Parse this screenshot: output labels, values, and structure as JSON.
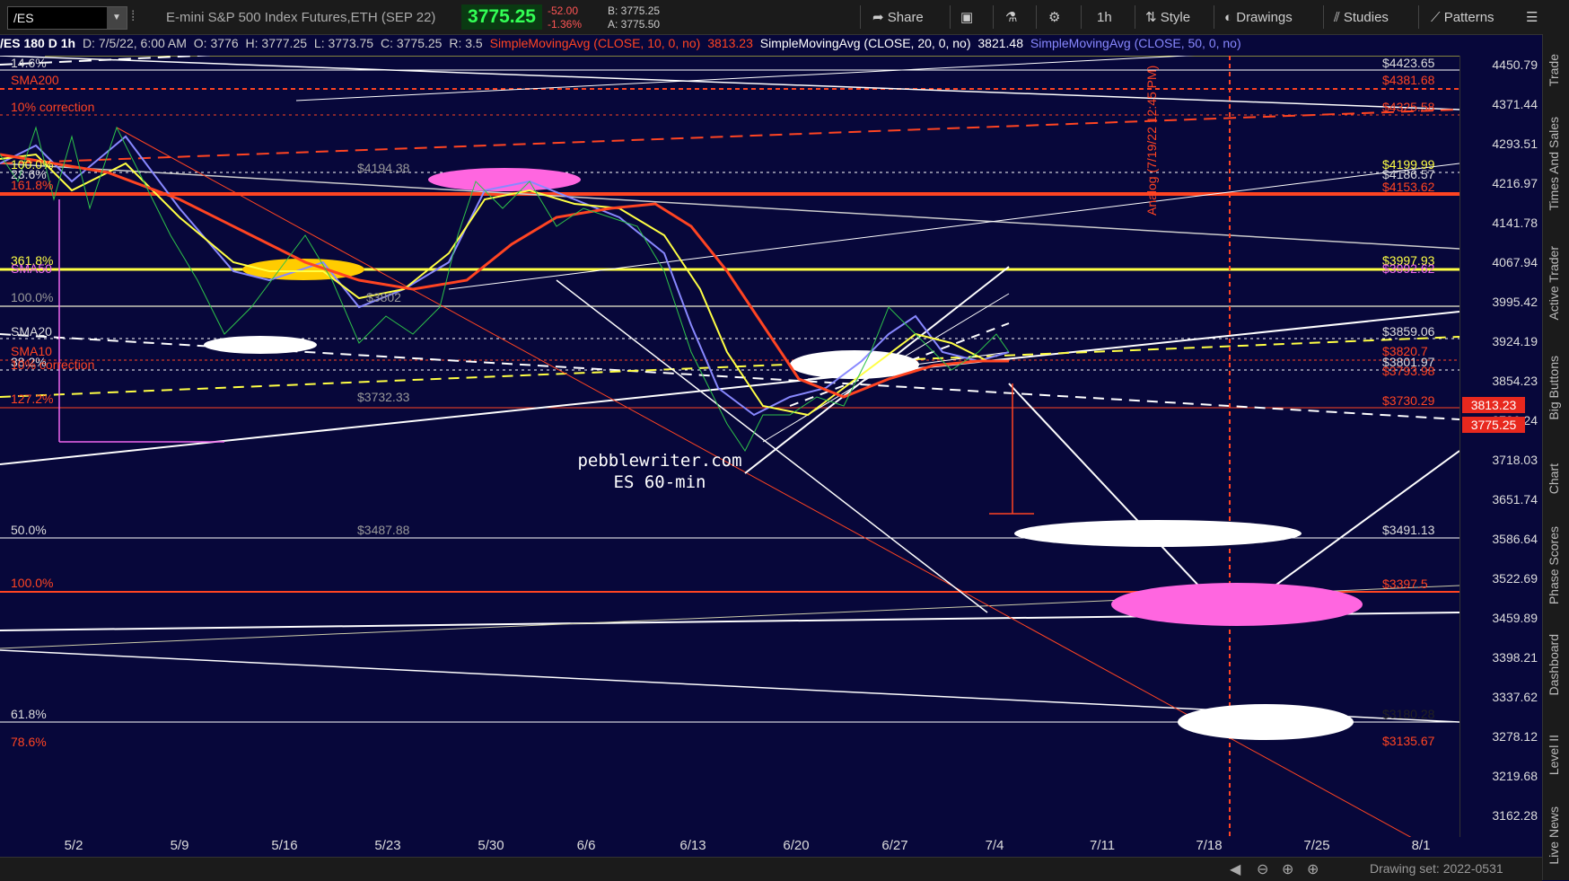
{
  "toolbar": {
    "symbol": "/ES",
    "instrument": "E-mini S&P 500 Index Futures,ETH (SEP 22)",
    "last_price": "3775.25",
    "net_change": "-52.00",
    "pct_change": "-1.36%",
    "bid": "B: 3775.25",
    "ask": "A: 3775.50",
    "buttons": {
      "share": "Share",
      "aggregation": "1h",
      "style": "Style",
      "drawings": "Drawings",
      "studies": "Studies",
      "patterns": "Patterns"
    }
  },
  "info": {
    "header": "/ES 180 D 1h",
    "date": "D: 7/5/22, 6:00 AM",
    "open": "O: 3776",
    "high": "H: 3777.25",
    "low": "L: 3773.75",
    "close": "C: 3775.25",
    "range": "R: 3.5",
    "sma10_label": "SimpleMovingAvg (CLOSE, 10, 0, no)",
    "sma10_value": "3813.23",
    "sma20_label": "SimpleMovingAvg (CLOSE, 20, 0, no)",
    "sma20_value": "3821.48",
    "sma50_label": "SimpleMovingAvg (CLOSE, 50, 0, no)"
  },
  "yaxis": {
    "ticks": [
      "4450.79",
      "4371.44",
      "4293.51",
      "4216.97",
      "4141.78",
      "4067.94",
      "3995.42",
      "3924.19",
      "3854.23",
      "3786.24",
      "3718.03",
      "3651.74",
      "3586.64",
      "3522.69",
      "3459.89",
      "3398.21",
      "3337.62",
      "3278.12",
      "3219.68",
      "3162.28"
    ],
    "tag_sma10": "3813.23",
    "tag_last": "3775.25"
  },
  "xaxis": {
    "labels": [
      "5/2",
      "5/9",
      "5/16",
      "5/23",
      "5/30",
      "6/6",
      "6/13",
      "6/20",
      "6/27",
      "7/4",
      "7/11",
      "7/18",
      "7/25",
      "8/1"
    ]
  },
  "levels": {
    "right": [
      {
        "text": "$4423.65",
        "color": "#ffffff"
      },
      {
        "text": "$4381.68",
        "color": "#ff4422"
      },
      {
        "text": "$4325.58",
        "color": "#ff4422"
      },
      {
        "text": "$4199.99",
        "color": "#ffff44"
      },
      {
        "text": "$4186.57",
        "color": "#ffffff"
      },
      {
        "text": "$4153.62",
        "color": "#ff4422"
      },
      {
        "text": "$3997.93",
        "color": "#ffff44"
      },
      {
        "text": "$3992.62",
        "color": "#ee66ee"
      },
      {
        "text": "$3859.06",
        "color": "#ffffff"
      },
      {
        "text": "$3820.7",
        "color": "#ff4422"
      },
      {
        "text": "$3801.97",
        "color": "#ffffff"
      },
      {
        "text": "$3793.98",
        "color": "#ff4422"
      },
      {
        "text": "$3730.29",
        "color": "#ff4422"
      },
      {
        "text": "$3491.13",
        "color": "#ffffff"
      },
      {
        "text": "$3397.5",
        "color": "#ff4422"
      },
      {
        "text": "$3180.28",
        "color": "#ffffff"
      },
      {
        "text": "$3135.67",
        "color": "#ff4422"
      }
    ],
    "left": [
      {
        "text": "14.6%",
        "color": "#ffffff"
      },
      {
        "text": "SMA200",
        "color": "#ff4422"
      },
      {
        "text": "10% correction",
        "color": "#ff4422"
      },
      {
        "text": "100.0%",
        "color": "#ffff44"
      },
      {
        "text": "161.8%",
        "color": "#ff4422"
      },
      {
        "text": "23.6%",
        "color": "#ffffff"
      },
      {
        "text": "361.8%",
        "color": "#ffff44"
      },
      {
        "text": "SMA50",
        "color": "#ee66ee"
      },
      {
        "text": "100.0%",
        "color": "#999999"
      },
      {
        "text": "SMA20",
        "color": "#ffffff"
      },
      {
        "text": "SMA10",
        "color": "#ff4422"
      },
      {
        "text": "38.2%",
        "color": "#ffffff"
      },
      {
        "text": "10% correction",
        "color": "#ff4422"
      },
      {
        "text": "127.2%",
        "color": "#ff4422"
      },
      {
        "text": "50.0%",
        "color": "#ffffff"
      },
      {
        "text": "100.0%",
        "color": "#ff4422"
      },
      {
        "text": "61.8%",
        "color": "#ffffff"
      },
      {
        "text": "78.6%",
        "color": "#ff4422"
      }
    ],
    "mid": [
      {
        "text": "$4194.38",
        "color": "#999999"
      },
      {
        "text": "$3732.33",
        "color": "#999999"
      },
      {
        "text": "$3487.88",
        "color": "#999999"
      },
      {
        "text": "$3802",
        "color": "#999999"
      }
    ]
  },
  "annotations": {
    "watermark_line1": "pebblewriter.com",
    "watermark_line2": "ES 60-min",
    "analog_label": "Analog (7/19/22 12:45 PM)"
  },
  "right_tabs": [
    "Trade",
    "Times And Sales",
    "Active Trader",
    "Big Buttons",
    "Chart",
    "Phase Scores",
    "Dashboard",
    "Level II",
    "Live News"
  ],
  "footer": {
    "drawing_set": "Drawing set: 2022-0531"
  },
  "colors": {
    "background": "#07073a",
    "sma10": "#ff4422",
    "sma20": "#ffff44",
    "sma50": "#8888ff",
    "highlight_pink": "#ff66e0",
    "last_price_green": "#33ff55"
  }
}
